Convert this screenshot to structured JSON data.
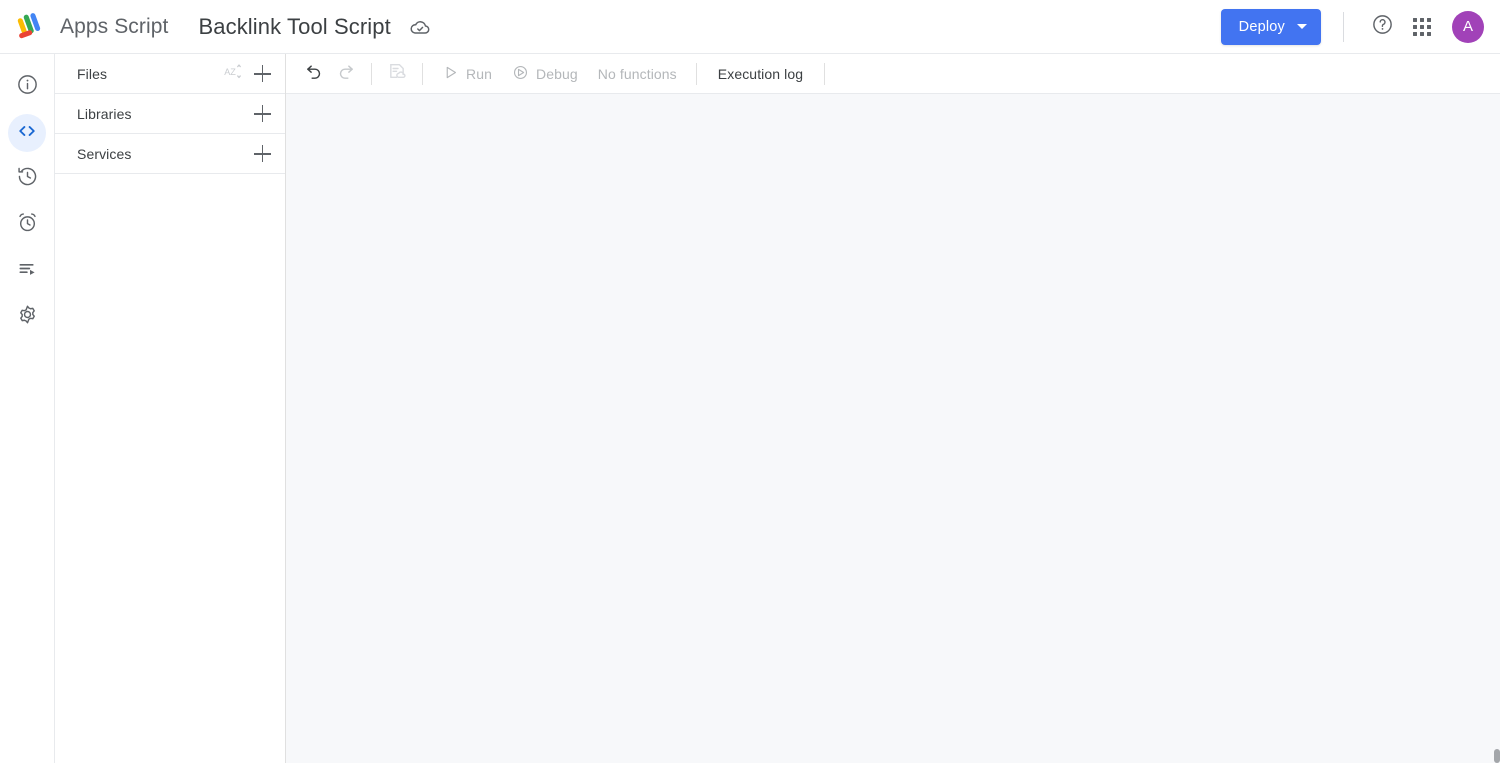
{
  "header": {
    "brand_name": "Apps Script",
    "brand_logo_icon": "apps-script-logo",
    "project_title": "Backlink Tool Script",
    "cloud_icon": "cloud-check-saved-icon",
    "deploy_label": "Deploy",
    "deploy_caret_icon": "chevron-down-icon",
    "help_icon": "help-circle-icon",
    "apps_grid_icon": "apps-grid-icon",
    "avatar_initial": "A",
    "colors": {
      "deploy_blue": "#4274f1",
      "avatar_purple": "#a142b8",
      "active_rail_blue": "#1967d2",
      "active_rail_bg": "#e8f0fe"
    }
  },
  "rail": {
    "items": [
      {
        "name": "overview",
        "icon": "info-circle-icon",
        "active": false
      },
      {
        "name": "editor",
        "icon": "code-brackets-icon",
        "active": true
      },
      {
        "name": "executions",
        "icon": "history-clock-icon",
        "active": false
      },
      {
        "name": "triggers",
        "icon": "alarm-clock-icon",
        "active": false
      },
      {
        "name": "project-history",
        "icon": "list-play-icon",
        "active": false
      },
      {
        "name": "project-settings",
        "icon": "gear-icon",
        "active": false
      }
    ]
  },
  "files_panel": {
    "sections": [
      {
        "label": "Files",
        "sort_icon": "sort-az-icon",
        "add_icon": "plus-icon"
      },
      {
        "label": "Libraries",
        "add_icon": "plus-icon"
      },
      {
        "label": "Services",
        "add_icon": "plus-icon"
      }
    ]
  },
  "toolbar": {
    "undo_icon": "undo-arrow-icon",
    "redo_icon": "redo-arrow-icon",
    "save_icon": "save-to-cloud-icon",
    "run_label": "Run",
    "run_icon": "play-triangle-icon",
    "debug_label": "Debug",
    "debug_icon": "debug-bug-icon",
    "function_selector_label": "No functions",
    "execution_log_label": "Execution log"
  },
  "editor": {
    "content": ""
  }
}
